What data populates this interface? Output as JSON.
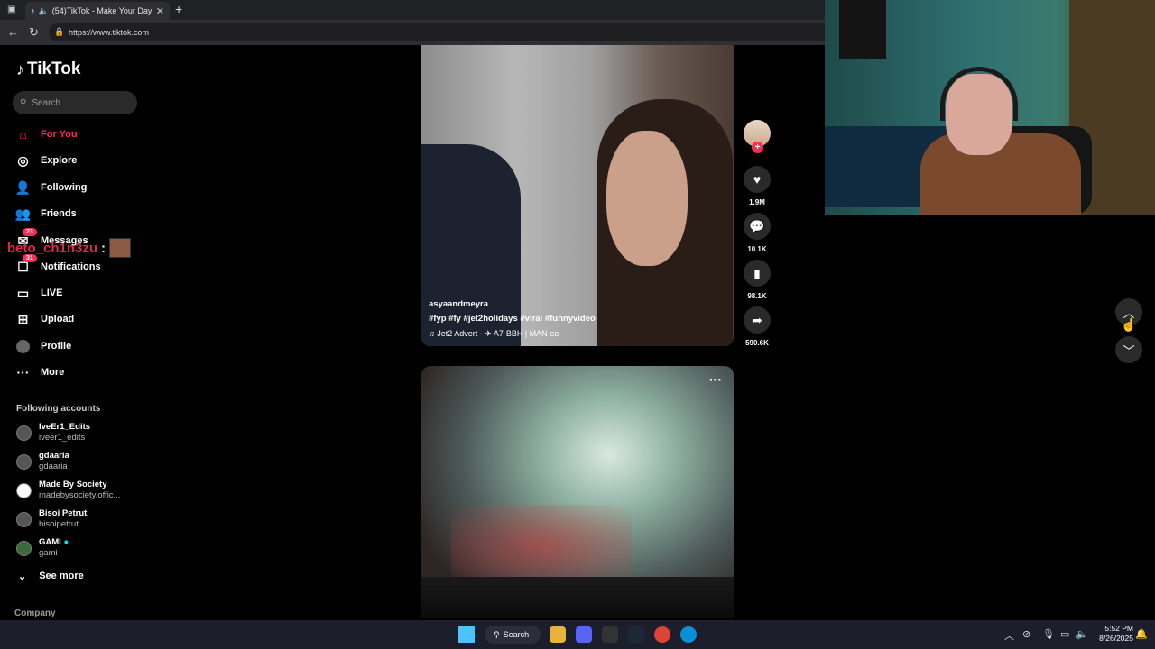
{
  "browser": {
    "tab_title": "(54)TikTok - Make Your Day",
    "tab_close": "✕",
    "new_tab": "+",
    "url": "https://www.tiktok.com"
  },
  "sidebar": {
    "logo": "TikTok",
    "search_placeholder": "Search",
    "nav": [
      {
        "label": "For You",
        "icon": "home-icon"
      },
      {
        "label": "Explore",
        "icon": "compass-icon"
      },
      {
        "label": "Following",
        "icon": "following-icon"
      },
      {
        "label": "Friends",
        "icon": "friends-icon"
      },
      {
        "label": "Messages",
        "icon": "messages-icon",
        "badge": "23"
      },
      {
        "label": "Notifications",
        "icon": "notifications-icon",
        "badge": "31"
      },
      {
        "label": "LIVE",
        "icon": "live-icon"
      },
      {
        "label": "Upload",
        "icon": "upload-icon"
      },
      {
        "label": "Profile",
        "icon": "profile-avatar"
      },
      {
        "label": "More",
        "icon": "more-icon"
      }
    ],
    "following_title": "Following accounts",
    "accounts": [
      {
        "name": "IveEr1_Edits",
        "handle": "iveer1_edits"
      },
      {
        "name": "gdaaria",
        "handle": "gdaaria"
      },
      {
        "name": "Made By Society",
        "handle": "madebysociety.offic..."
      },
      {
        "name": "Bisoi Petrut",
        "handle": "bisoipetrut"
      },
      {
        "name": "GAMI",
        "handle": "gami"
      }
    ],
    "see_more": "See more",
    "company": "Company"
  },
  "overlay_chat": {
    "username": "beto_ch1n3zu",
    "separator": ":"
  },
  "video1": {
    "username": "asyaandmeyra",
    "hashtags": "#fyp  #fy  #jet2holidays  #viral  #funnyvideo",
    "music": "♫  Jet2 Advert - ✈ A7-BBH | MAN",
    "music_suffix": "GB",
    "likes": "1.9M",
    "comments": "10.1K",
    "saves": "98.1K",
    "shares": "590.6K"
  },
  "video2": {
    "more": "···"
  },
  "taskbar": {
    "search": "Search",
    "time": "5:52 PM",
    "date": "8/26/2025"
  }
}
